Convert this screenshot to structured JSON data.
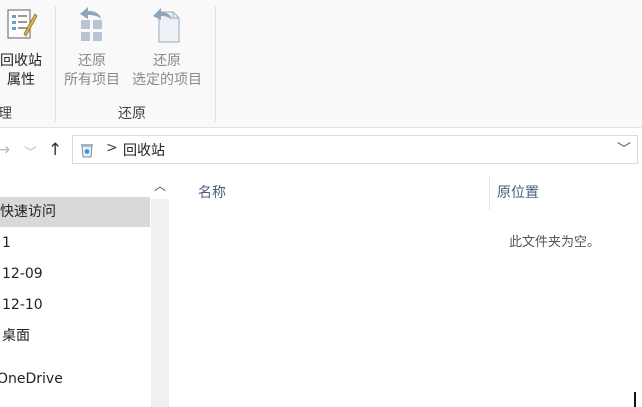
{
  "ribbon": {
    "manage_group": {
      "label": "理",
      "properties_button": {
        "line1": "回收站",
        "line2": "属性",
        "icon": "recycle-bin-properties-icon"
      }
    },
    "restore_group": {
      "label": "还原",
      "restore_all_button": {
        "line1": "还原",
        "line2": "所有项目",
        "icon": "restore-all-icon"
      },
      "restore_selected_button": {
        "line1": "还原",
        "line2": "选定的项目",
        "icon": "restore-selected-icon"
      }
    }
  },
  "address": {
    "back_icon": "back-arrow-icon",
    "forward_icon": "forward-arrow-icon",
    "recent_icon": "chevron-down-icon",
    "up_icon": "up-arrow-icon",
    "location_icon": "recycle-bin-icon",
    "separator": ">",
    "current": "回收站",
    "dropdown_icon": "chevron-down-icon"
  },
  "navpane": {
    "items": [
      {
        "label": "快速访问",
        "selected": true
      },
      {
        "label": "1"
      },
      {
        "label": "12-09"
      },
      {
        "label": "12-10"
      },
      {
        "label": "桌面"
      },
      {
        "label": "OneDrive"
      }
    ]
  },
  "content": {
    "columns": [
      "名称",
      "原位置"
    ],
    "empty_message": "此文件夹为空。"
  },
  "colors": {
    "selected_bg": "#d9d9d9",
    "column_header": "#4c607a",
    "ribbon_bg": "#f9f9f9"
  }
}
